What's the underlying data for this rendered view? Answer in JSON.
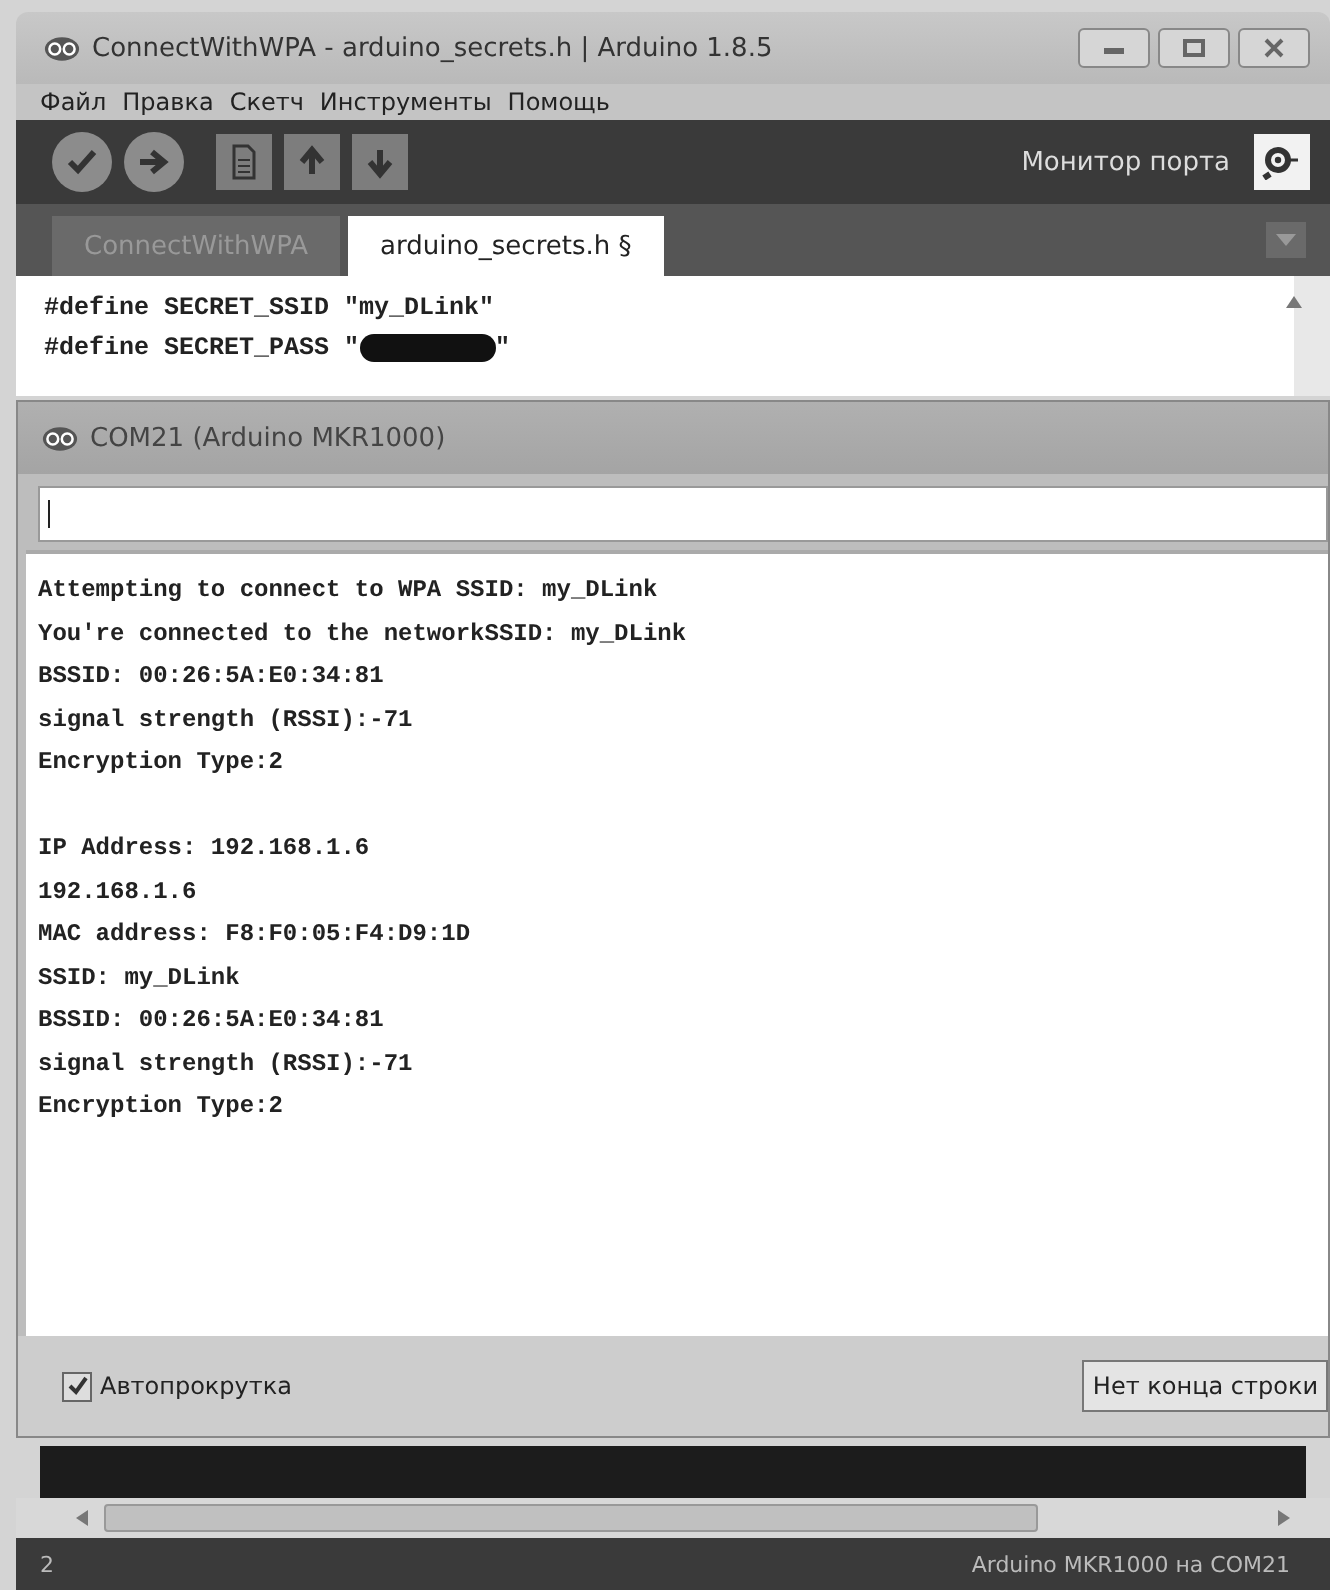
{
  "window": {
    "title": "ConnectWithWPA - arduino_secrets.h | Arduino 1.8.5"
  },
  "menu": [
    "Файл",
    "Правка",
    "Скетч",
    "Инструменты",
    "Помощь"
  ],
  "toolbar": {
    "serial_monitor_label": "Монитор порта"
  },
  "tabs": [
    {
      "label": "ConnectWithWPA",
      "selected": false
    },
    {
      "label": "arduino_secrets.h §",
      "selected": true
    }
  ],
  "code_lines": [
    {
      "text": "#define SECRET_SSID \"my_DLink\"",
      "redacted": false
    },
    {
      "text": "#define SECRET_PASS \"",
      "redacted": true,
      "after": "\""
    }
  ],
  "serial_monitor": {
    "title": "COM21 (Arduino MKR1000)",
    "output": [
      {
        "kind": "text",
        "text": "Attempting to connect to WPA SSID: my_DLink"
      },
      {
        "kind": "text",
        "text": "You're connected to the networkSSID: my_DLink"
      },
      {
        "kind": "text",
        "text": "BSSID: 00:26:5A:E0:34:81"
      },
      {
        "kind": "text",
        "text": "signal strength (RSSI):-71"
      },
      {
        "kind": "text",
        "text": "Encryption Type:2"
      },
      {
        "kind": "blank"
      },
      {
        "kind": "text",
        "text": "IP Address: 192.168.1.6"
      },
      {
        "kind": "text",
        "text": "192.168.1.6"
      },
      {
        "kind": "text",
        "text": "MAC address: F8:F0:05:F4:D9:1D"
      },
      {
        "kind": "text",
        "text": "SSID: my_DLink"
      },
      {
        "kind": "text",
        "text": "BSSID: 00:26:5A:E0:34:81"
      },
      {
        "kind": "text",
        "text": "signal strength (RSSI):-71"
      },
      {
        "kind": "text",
        "text": "Encryption Type:2"
      }
    ],
    "autoscroll": {
      "label": "Автопрокрутка",
      "checked": true
    },
    "line_ending": "Нет конца строки"
  },
  "status_bar": {
    "line": "2",
    "board": "Arduino MKR1000 на COM21"
  }
}
